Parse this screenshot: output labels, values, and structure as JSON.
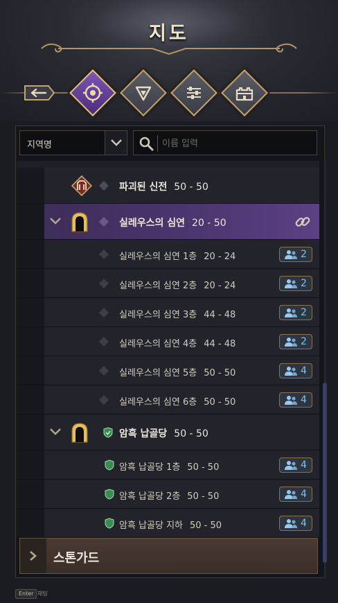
{
  "window": {
    "title": "지도"
  },
  "nav": {
    "tabs": [
      {
        "name": "back",
        "icon": "back-arrow-icon"
      },
      {
        "name": "map",
        "icon": "compass-icon",
        "active": true
      },
      {
        "name": "filter",
        "icon": "funnel-icon"
      },
      {
        "name": "settings",
        "icon": "sliders-icon"
      },
      {
        "name": "castle",
        "icon": "castle-icon"
      }
    ]
  },
  "search": {
    "select_value": "지역명",
    "placeholder": "이름 입력"
  },
  "list": {
    "items": [
      {
        "name": "파괴된 신전",
        "range": "50 - 50",
        "level": 1,
        "icon": "ruins-icon"
      },
      {
        "name": "실레우스의 심연",
        "range": "20 - 50",
        "level": 1,
        "expanded": true,
        "selected": true,
        "icon": "gate-icon"
      },
      {
        "name": "실레우스의 심연 1층",
        "range": "20 - 24",
        "level": 2,
        "party": "2"
      },
      {
        "name": "실레우스의 심연 2층",
        "range": "20 - 24",
        "level": 2,
        "party": "2"
      },
      {
        "name": "실레우스의 심연 3층",
        "range": "44 - 48",
        "level": 2,
        "party": "2"
      },
      {
        "name": "실레우스의 심연 4층",
        "range": "44 - 48",
        "level": 2,
        "party": "2"
      },
      {
        "name": "실레우스의 심연 5층",
        "range": "50 - 50",
        "level": 2,
        "party": "4"
      },
      {
        "name": "실레우스의 심연 6층",
        "range": "50 - 50",
        "level": 2,
        "party": "4"
      },
      {
        "name": "암흑 납골당",
        "range": "50 - 50",
        "level": 1,
        "expanded": true,
        "icon": "gate-icon"
      },
      {
        "name": "암흑 납골당 1층",
        "range": "50 - 50",
        "level": 2,
        "party": "4"
      },
      {
        "name": "암흑 납골당 2층",
        "range": "50 - 50",
        "level": 2,
        "party": "4"
      },
      {
        "name": "암흑 납골당 지하",
        "range": "50 - 50",
        "level": 2,
        "party": "4"
      }
    ]
  },
  "region": {
    "label": "스톤가드"
  },
  "footer": {
    "key": "Enter",
    "text": "채팅"
  },
  "colors": {
    "accent_purple": "#4c3670",
    "party_count": "#7cc4f2",
    "gold_border": "#c4a46e"
  }
}
